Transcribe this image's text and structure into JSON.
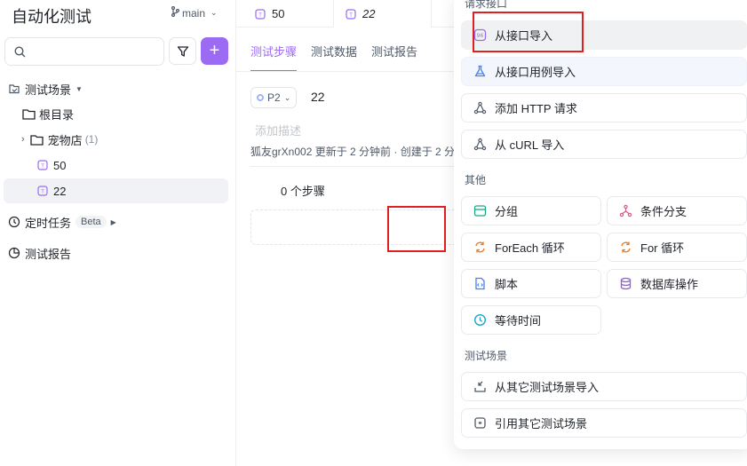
{
  "sidebar": {
    "title": "自动化测试",
    "branch": "main",
    "scenarios_label": "测试场景",
    "root_folder": "根目录",
    "pet_folder": "宠物店",
    "pet_count": "(1)",
    "case_50": "50",
    "case_22": "22",
    "scheduled_label": "定时任务",
    "beta": "Beta",
    "reports_label": "测试报告"
  },
  "tabs": [
    {
      "label": "50"
    },
    {
      "label": "22"
    }
  ],
  "main": {
    "subtabs": [
      "测试步骤",
      "测试数据",
      "测试报告"
    ],
    "priority": "P2",
    "case_name": "22",
    "description_placeholder": "添加描述",
    "meta": "狐友grXn002 更新于 2 分钟前 · 创建于 2 分",
    "step_count": "0 个步骤"
  },
  "menu": {
    "section_request": "请求接口",
    "import_from_api": "从接口导入",
    "import_from_api_case": "从接口用例导入",
    "add_http": "添加 HTTP 请求",
    "import_curl": "从 cURL 导入",
    "section_other": "其他",
    "group": "分组",
    "condition": "条件分支",
    "foreach": "ForEach 循环",
    "for_loop": "For 循环",
    "script": "脚本",
    "db_op": "数据库操作",
    "wait": "等待时间",
    "section_scenario": "测试场景",
    "import_other_scenario": "从其它测试场景导入",
    "reference_scenario": "引用其它测试场景"
  },
  "colors": {
    "accent": "#9b6cf3",
    "highlight_red": "#e02020"
  }
}
